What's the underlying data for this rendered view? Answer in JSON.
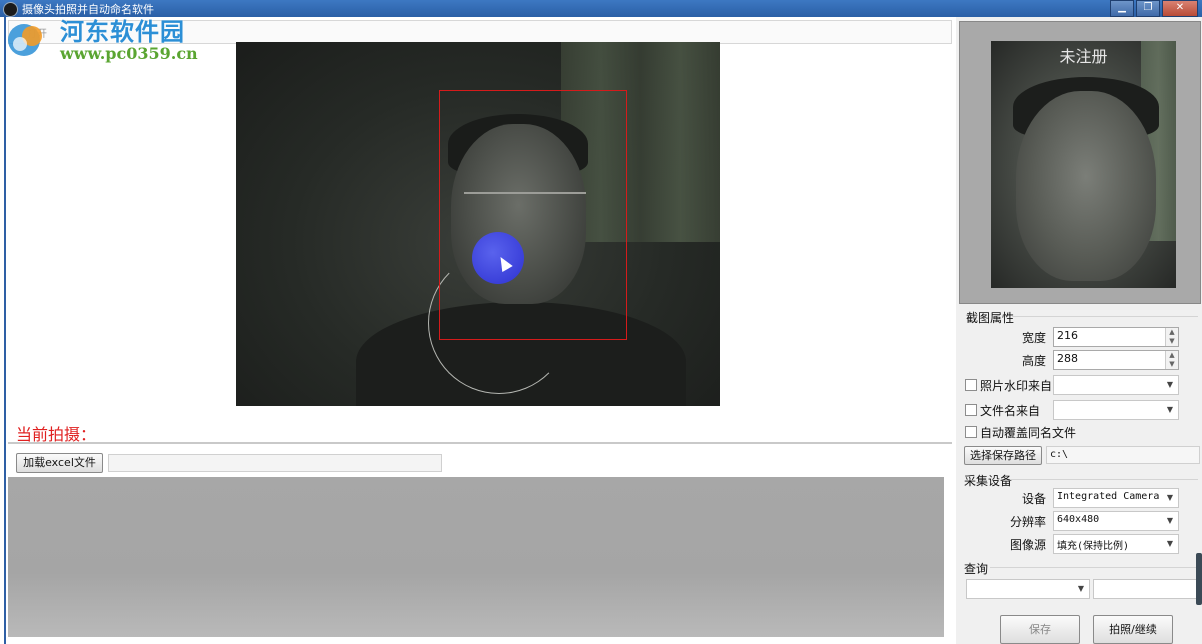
{
  "window": {
    "title": "摄像头拍照并自动命名软件",
    "controls": {
      "minimize": "▁",
      "maximize": "❐",
      "close": "✕"
    }
  },
  "watermark": {
    "site_name": "河东软件园",
    "site_url": "www.pc0359.cn"
  },
  "topbar": {
    "hint": "打开"
  },
  "main": {
    "current_shot_label": "当前拍摄：",
    "load_excel_button": "加载excel文件",
    "excel_path": ""
  },
  "preview": {
    "overlay_text": "未注册"
  },
  "crop": {
    "group_label": "截图属性",
    "width_label": "宽度",
    "width_value": "216",
    "height_label": "高度",
    "height_value": "288",
    "watermark_from_label": "照片水印来自",
    "watermark_from_value": "",
    "watermark_checked": false,
    "filename_from_label": "文件名来自",
    "filename_from_value": "",
    "filename_checked": false,
    "overwrite_label": "自动覆盖同名文件",
    "overwrite_checked": false,
    "choose_path_button": "选择保存路径",
    "save_path": "c:\\"
  },
  "capture": {
    "group_label": "采集设备",
    "device_label": "设备",
    "device_value": "Integrated Camera",
    "resolution_label": "分辨率",
    "resolution_value": "640x480",
    "source_label": "图像源",
    "source_value": "填充(保持比例)"
  },
  "query": {
    "group_label": "查询",
    "field_value": "",
    "text_value": ""
  },
  "actions": {
    "save_button": "保存",
    "shoot_button": "拍照/继续"
  },
  "colors": {
    "titlebar": "#2a5fa6",
    "current_shot": "#e02020",
    "face_box": "#d51b1b",
    "cursor_dot": "#2a2ee0",
    "grid_bg": "#a7a7a7"
  }
}
